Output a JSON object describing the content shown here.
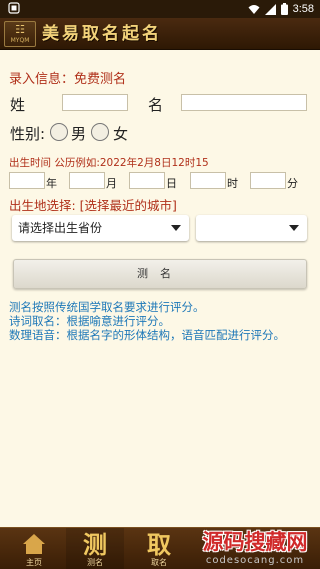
{
  "status_bar": {
    "time": "3:58",
    "icons": [
      "app-notification-icon",
      "wifi-icon",
      "signal-icon",
      "battery-icon"
    ]
  },
  "header": {
    "logo_mark": "MYQM",
    "title": "美易取名起名"
  },
  "form": {
    "info_label": "录入信息：",
    "info_value": "免费测名",
    "surname_label": "姓",
    "given_name_label": "名",
    "surname_value": "",
    "given_name_value": "",
    "gender_label": "性别:",
    "gender_options": [
      "男",
      "女"
    ],
    "birth_time_hint": "出生时间 公历例如:2022年2月8日12时15",
    "date_units": [
      "年",
      "月",
      "日",
      "时",
      "分"
    ],
    "date_values": [
      "",
      "",
      "",
      "",
      ""
    ],
    "birthplace_label": "出生地选择: [选择最近的城市]",
    "province_select": "请选择出生省份",
    "city_select": "",
    "submit_label": "测名"
  },
  "descriptions": [
    "测名按照传统国学取名要求进行评分。",
    "诗词取名：根据喻意进行评分。",
    "数理语音：根据名字的形体结构，语音匹配进行评分。"
  ],
  "bottom_nav": [
    {
      "big": "",
      "small": "主页",
      "icon": "home-icon"
    },
    {
      "big": "测",
      "small": "测名"
    },
    {
      "big": "取",
      "small": "取名"
    }
  ],
  "watermark": {
    "cn": "源码搜藏网",
    "en": "codesocang.com"
  },
  "colors": {
    "background": "#fdf8e6",
    "header": "#3a2008",
    "accent_red": "#b0301a",
    "desc_blue": "#1e78b8",
    "gold": "#f0c860"
  }
}
